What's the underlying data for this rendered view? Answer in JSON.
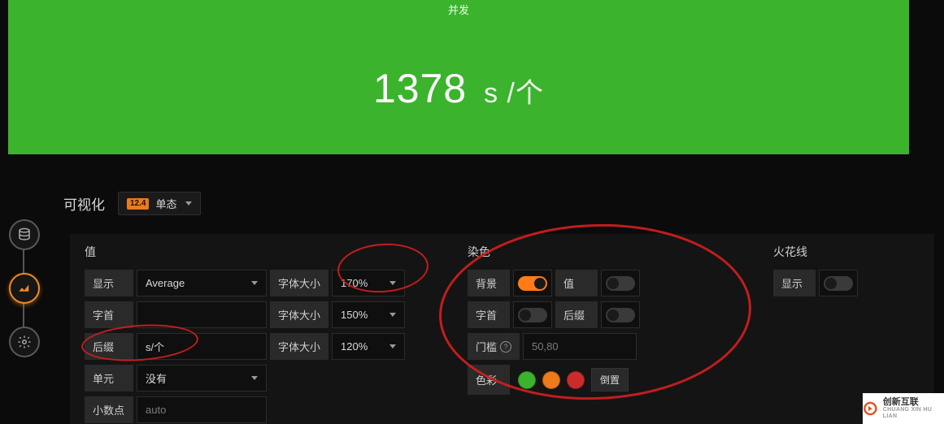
{
  "hero": {
    "title": "并发",
    "value": "1378",
    "suffix": "s /个"
  },
  "viz_header": {
    "label": "可视化",
    "type_badge": "12.4",
    "type_name": "单态"
  },
  "rail_icons": [
    "database-icon",
    "chart-icon",
    "gear-icon"
  ],
  "value_section": {
    "title": "值",
    "display_label": "显示",
    "display_value": "Average",
    "font_label": "字体大小",
    "font1": "170%",
    "prefix_label": "字首",
    "prefix_value": "",
    "font2": "150%",
    "suffix_label": "后缀",
    "suffix_value": "s/个",
    "font3": "120%",
    "unit_label": "单元",
    "unit_value": "没有",
    "decimal_label": "小数点",
    "decimal_placeholder": "auto"
  },
  "color_section": {
    "title": "染色",
    "bg_label": "背景",
    "bg_on": true,
    "value_label": "值",
    "value_on": false,
    "prefix_label": "字首",
    "prefix_on": false,
    "suffix_label": "后缀",
    "suffix_on": false,
    "threshold_label": "门槛",
    "threshold_value": "50,80",
    "color_label": "色彩",
    "invert_btn": "倒置",
    "swatches": [
      "green",
      "orange",
      "red"
    ]
  },
  "spark_section": {
    "title": "火花线",
    "show_label": "显示",
    "show_on": false
  },
  "watermark": {
    "cn": "创新互联",
    "en": "CHUANG XIN HU LIAN"
  }
}
